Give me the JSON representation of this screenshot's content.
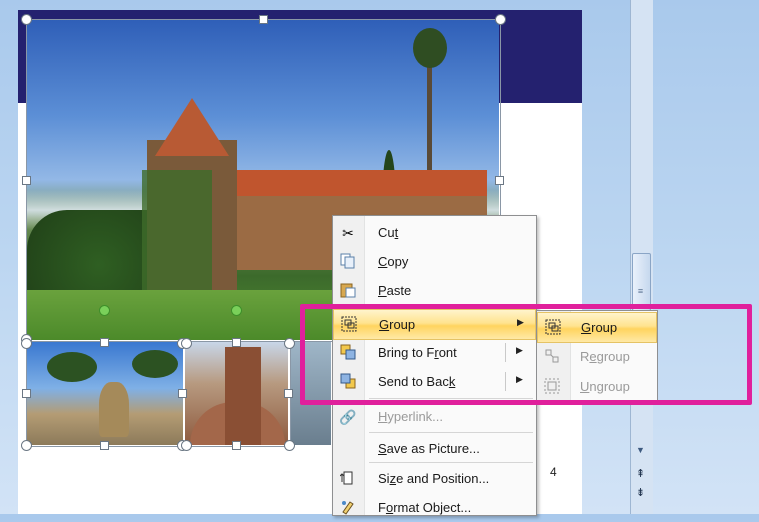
{
  "context_menu": {
    "items": [
      {
        "label_pre": "Cu",
        "label_u": "t",
        "label_post": "",
        "icon": "scissors-icon"
      },
      {
        "label_pre": "",
        "label_u": "C",
        "label_post": "opy",
        "icon": "copy-icon"
      },
      {
        "label_pre": "",
        "label_u": "P",
        "label_post": "aste",
        "icon": "paste-icon"
      },
      {
        "label_pre": "",
        "label_u": "G",
        "label_post": "roup",
        "icon": "group-icon",
        "submenu": true
      },
      {
        "label_pre": "Bring to F",
        "label_u": "r",
        "label_post": "ont",
        "icon": "bring-to-front-icon",
        "submenu": true
      },
      {
        "label_pre": "Send to Bac",
        "label_u": "k",
        "label_post": "",
        "icon": "send-to-back-icon",
        "submenu": true
      },
      {
        "label_pre": "",
        "label_u": "H",
        "label_post": "yperlink...",
        "icon": "hyperlink-icon",
        "disabled": true
      },
      {
        "label_pre": "",
        "label_u": "S",
        "label_post": "ave as Picture...",
        "icon": ""
      },
      {
        "label_pre": "Si",
        "label_u": "z",
        "label_post": "e and Position...",
        "icon": "size-position-icon"
      },
      {
        "label_pre": "F",
        "label_u": "o",
        "label_post": "rmat Object...",
        "icon": "format-object-icon"
      }
    ]
  },
  "group_submenu": {
    "items": [
      {
        "label_pre": "",
        "label_u": "G",
        "label_post": "roup",
        "icon": "group-icon"
      },
      {
        "label_pre": "R",
        "label_u": "e",
        "label_post": "group",
        "icon": "regroup-icon",
        "disabled": true
      },
      {
        "label_pre": "",
        "label_u": "U",
        "label_post": "ngroup",
        "icon": "ungroup-icon",
        "disabled": true
      }
    ]
  },
  "slide": {
    "slide_number": "4"
  },
  "colors": {
    "highlight_box": "#e0209c",
    "menu_highlight": "#ffd45f",
    "slide_band": "#24216f"
  }
}
